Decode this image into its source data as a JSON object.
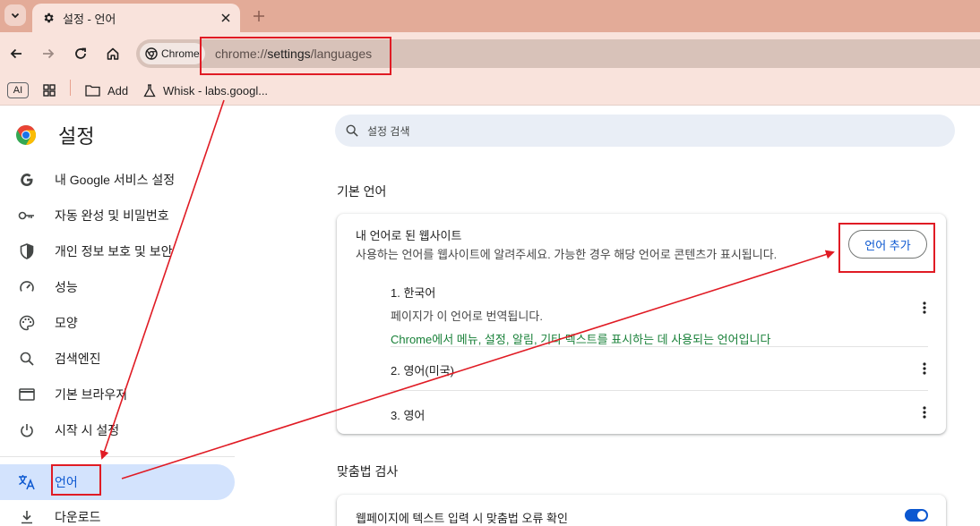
{
  "tab": {
    "title": "설정 - 언어",
    "close_icon": "close-icon",
    "new_tab_icon": "plus-icon"
  },
  "omnibox": {
    "chip_label": "Chrome",
    "url_scheme": "chrome://",
    "url_host": "settings",
    "url_path": "/languages"
  },
  "bookmarks": {
    "ai_label": "AI",
    "add_label": "Add",
    "whisk_label": "Whisk - labs.googl..."
  },
  "sidebar": {
    "title": "설정",
    "items": [
      {
        "label": "내 Google 서비스 설정",
        "icon": "google-g-icon"
      },
      {
        "label": "자동 완성 및 비밀번호",
        "icon": "key-icon"
      },
      {
        "label": "개인 정보 보호 및 보안",
        "icon": "shield-icon"
      },
      {
        "label": "성능",
        "icon": "speedometer-icon"
      },
      {
        "label": "모양",
        "icon": "palette-icon"
      },
      {
        "label": "검색엔진",
        "icon": "search-icon"
      },
      {
        "label": "기본 브라우저",
        "icon": "browser-window-icon"
      },
      {
        "label": "시작 시 설정",
        "icon": "power-icon"
      },
      {
        "label": "언어",
        "icon": "translate-icon",
        "active": true
      },
      {
        "label": "다운로드",
        "icon": "download-icon"
      }
    ]
  },
  "main": {
    "search_placeholder": "설정 검색",
    "section_default_language": "기본 언어",
    "card_title": "내 언어로 된 웹사이트",
    "card_subtitle": "사용하는 언어를 웹사이트에 알려주세요. 가능한 경우 해당 언어로 콘텐츠가 표시됩니다.",
    "add_language_button": "언어 추가",
    "languages": [
      {
        "name": "1. 한국어",
        "desc": "페이지가 이 언어로 번역됩니다.",
        "ui_note": "Chrome에서 메뉴, 설정, 알림, 기타 텍스트를 표시하는 데 사용되는 언어입니다"
      },
      {
        "name": "2. 영어(미국)"
      },
      {
        "name": "3. 영어"
      }
    ],
    "section_spellcheck": "맞춤법 검사",
    "spellcheck_label": "웹페이지에 텍스트 입력 시 맞춤법 오류 확인",
    "spellcheck_enabled": true
  },
  "colors": {
    "accent": "#0b57d0",
    "annotation_red": "#e01b24",
    "ui_language_green": "#188038"
  }
}
